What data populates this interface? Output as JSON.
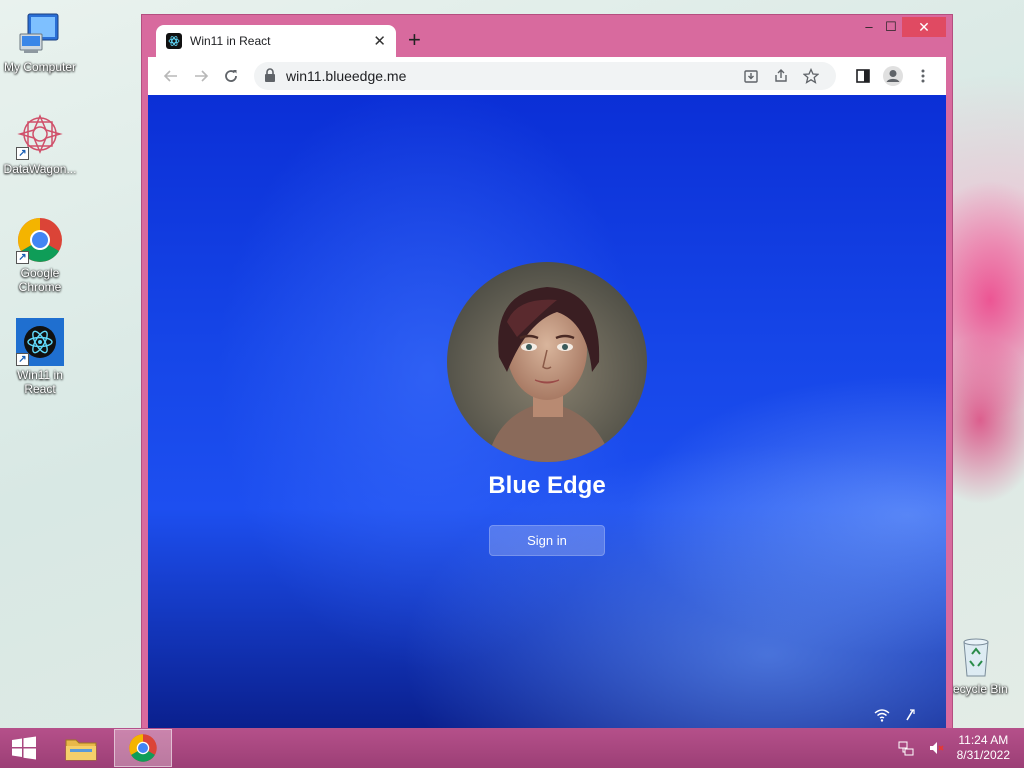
{
  "desktop": {
    "icons": [
      {
        "label": "My Computer"
      },
      {
        "label": "DataWagon..."
      },
      {
        "label": "Google Chrome"
      },
      {
        "label": "Win11 in React"
      },
      {
        "label": "Recycle Bin"
      }
    ]
  },
  "browser": {
    "tab": {
      "title": "Win11 in React",
      "close": "✕"
    },
    "new_tab": "+",
    "window_controls": {
      "minimize": "–",
      "maximize": "☐",
      "close": "✕"
    },
    "address_bar": {
      "url": "win11.blueedge.me"
    }
  },
  "page": {
    "user_name": "Blue Edge",
    "sign_in_label": "Sign in"
  },
  "taskbar": {
    "clock": {
      "time": "11:24 AM",
      "date": "8/31/2022"
    }
  },
  "colors": {
    "window_frame": "#d86a9e",
    "taskbar": "#b5508a",
    "page_blue": "#1646e8"
  }
}
